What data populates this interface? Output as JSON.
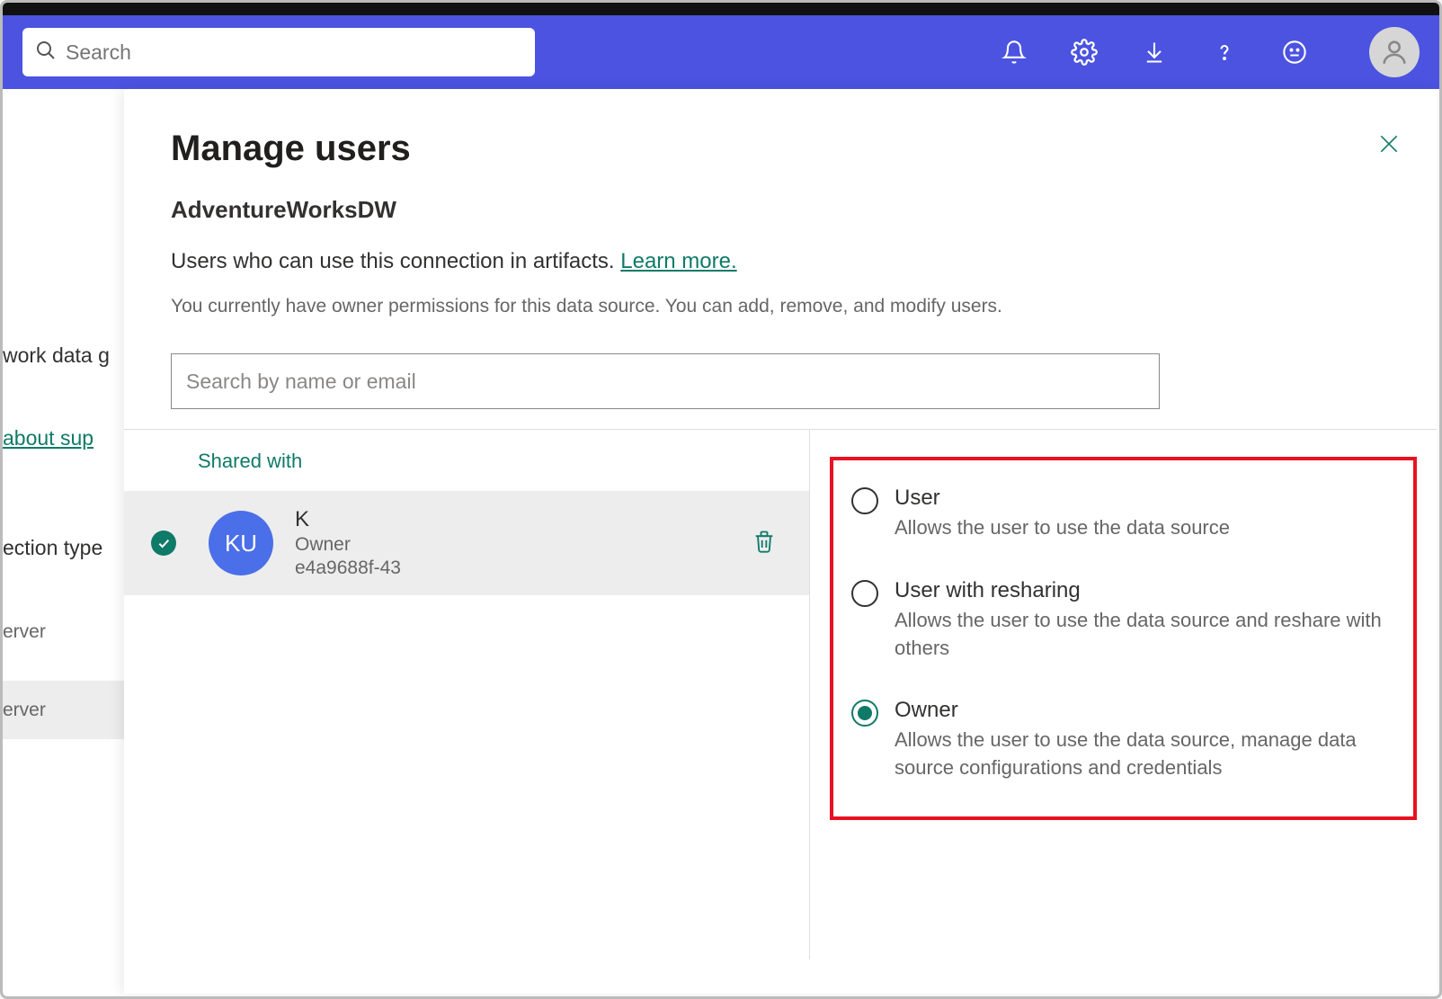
{
  "header": {
    "search_placeholder": "Search"
  },
  "background": {
    "row1": "work data g",
    "link": "about sup",
    "row2": "ection type",
    "sub1": "erver",
    "sub2": "erver"
  },
  "panel": {
    "title": "Manage users",
    "subtitle": "AdventureWorksDW",
    "desc_prefix": "Users who can use this connection in artifacts. ",
    "learn_more": "Learn more.",
    "note": "You currently have owner permissions for this data source. You can add, remove, and modify users.",
    "user_search_placeholder": "Search by name or email",
    "shared_with": "Shared with"
  },
  "user": {
    "initials": "KU",
    "name": "K",
    "role": "Owner",
    "id": "e4a9688f-43"
  },
  "roles": [
    {
      "key": "user",
      "title": "User",
      "desc": "Allows the user to use the data source",
      "selected": false
    },
    {
      "key": "user-resharing",
      "title": "User with resharing",
      "desc": "Allows the user to use the data source and reshare with others",
      "selected": false
    },
    {
      "key": "owner",
      "title": "Owner",
      "desc": "Allows the user to use the data source, manage data source configurations and credentials",
      "selected": true
    }
  ]
}
